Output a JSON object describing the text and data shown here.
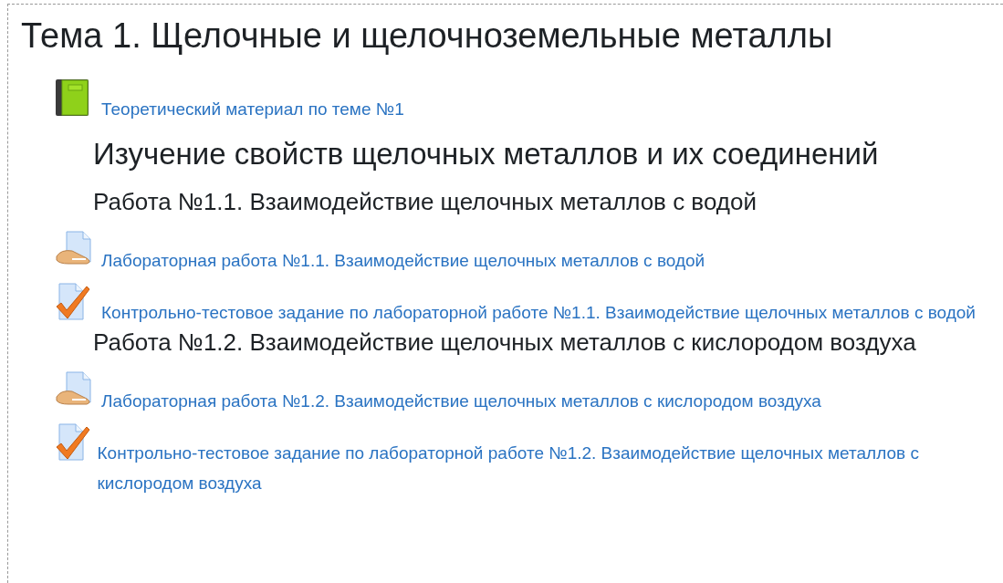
{
  "section": {
    "title": "Тема 1. Щелочные и щелочноземельные металлы",
    "items": [
      {
        "kind": "book",
        "text": "Теоретический материал по теме №1"
      },
      {
        "kind": "heading",
        "text": "Изучение свойств щелочных металлов и их соединений"
      },
      {
        "kind": "subheading",
        "text": "Работа №1.1. Взаимодействие щелочных металлов с водой"
      },
      {
        "kind": "assignment",
        "text": "Лабораторная работа №1.1. Взаимодействие щелочных металлов с водой"
      },
      {
        "kind": "quiz",
        "text": "Контрольно-тестовое задание по лабораторной работе №1.1. Взаимодействие щелочных металлов с водой"
      },
      {
        "kind": "subheading",
        "text": "Работа №1.2. Взаимодействие щелочных металлов с кислородом воздуха"
      },
      {
        "kind": "assignment",
        "text": "Лабораторная работа №1.2. Взаимодействие щелочных металлов с кислородом воздуха"
      },
      {
        "kind": "quiz",
        "text": "Контрольно-тестовое задание по лабораторной работе №1.2. Взаимодействие щелочных металлов с кислородом воздуха"
      }
    ]
  }
}
